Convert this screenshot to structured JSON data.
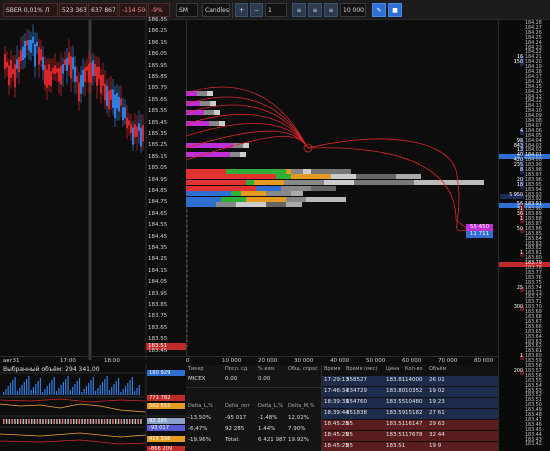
{
  "toolbar": {
    "ticker": "SBER 0,01% Л",
    "ticker_val1": "523 363",
    "ticker_val2": "637 867",
    "ticker_val3": "-114 504",
    "ticker_pct": "-9%",
    "mode": "SM",
    "chart_type": "Candles",
    "interval": "1",
    "volume_filter": "10 000"
  },
  "price_axis_left": [
    "186.35",
    "186.25",
    "186.15",
    "186.05",
    "185.95",
    "185.85",
    "185.75",
    "185.65",
    "185.55",
    "185.45",
    "185.35",
    "185.25",
    "185.15",
    "185.05",
    "184.95",
    "184.85",
    "184.75",
    "184.65",
    "184.55",
    "184.45",
    "184.35",
    "184.25",
    "184.15",
    "184.05",
    "183.95",
    "183.85",
    "183.75",
    "183.65",
    "183.55",
    "183.45"
  ],
  "current_price_left": "183.51",
  "time_axis": [
    "авг31",
    "17:00",
    "18:00"
  ],
  "selected_volume_label": "Выбранный объём: 294 341,00",
  "indicator_values": [
    "180 929",
    "771 782",
    "502 553",
    "92 285",
    "-93 017",
    "415 556",
    "-866 209"
  ],
  "cluster_axis": [
    "0",
    "10 000",
    "20 000",
    "30 000",
    "40 000",
    "50 000",
    "60 000",
    "70 000",
    "80 000"
  ],
  "cluster_labels": [
    "4",
    "1",
    "3",
    "3",
    "1",
    "2",
    "1",
    "2",
    "2"
  ],
  "cluster_pos_badges": [
    "1",
    "2"
  ],
  "order_tag_sell": "55 450",
  "order_tag_buy": "11 711",
  "orderbook": {
    "prices": [
      "184.28",
      "184.27",
      "184.26",
      "184.25",
      "184.24",
      "184.23",
      "184.22",
      "184.21",
      "184.20",
      "184.19",
      "184.18",
      "184.17",
      "184.16",
      "184.15",
      "184.14",
      "184.13",
      "184.12",
      "184.11",
      "184.10",
      "184.09",
      "184.08",
      "184.07",
      "184.06",
      "184.05",
      "184.04",
      "184.03",
      "184.02",
      "184.01",
      "184.00",
      "183.99",
      "183.98",
      "183.97",
      "183.96",
      "183.95",
      "183.94",
      "183.93",
      "183.92",
      "183.91",
      "183.90",
      "183.89",
      "183.88",
      "183.87",
      "183.86",
      "183.85",
      "183.84",
      "183.83",
      "183.82",
      "183.81",
      "183.80",
      "183.79",
      "183.78",
      "183.77",
      "183.76",
      "183.75",
      "183.74",
      "183.73",
      "183.72",
      "183.71",
      "183.70",
      "183.69",
      "183.68",
      "183.67",
      "183.66",
      "183.65",
      "183.64",
      "183.63",
      "183.62",
      "183.61",
      "183.60",
      "183.59",
      "183.58",
      "183.57",
      "183.56",
      "183.55",
      "183.54",
      "183.53",
      "183.52",
      "183.51",
      "183.50",
      "183.49",
      "183.48",
      "183.47",
      "183.46",
      "183.45",
      "183.44",
      "183.43",
      "183.42",
      "183.41",
      "183.40"
    ],
    "volumes": {
      "184.21": "16",
      "184.20": "150",
      "184.06": "4",
      "184.04": "98",
      "184.03": "843",
      "184.02": "13",
      "184.01": "40",
      "184.00": "420",
      "183.99": "235",
      "183.98": "8",
      "183.96": "20",
      "183.95": "18",
      "183.93": "5 950",
      "183.91": "56",
      "183.90": "31",
      "183.89": "36",
      "183.88": "1",
      "183.86": "50",
      "183.81": "1",
      "183.74": "25",
      "183.70": "300",
      "183.60": "1",
      "183.57": "200"
    },
    "volume_ratio": {
      "184.21": 0.01,
      "184.20": 0.02,
      "184.06": 0.003,
      "184.04": 0.015,
      "184.03": 0.14,
      "184.02": 0.002,
      "184.01": 0.006,
      "184.00": 0.07,
      "183.99": 0.04,
      "183.98": 0.002,
      "183.96": 0.003,
      "183.95": 0.003,
      "183.93": 1.0,
      "183.91": 0.009,
      "183.90": 0.005,
      "183.89": 0.006,
      "183.88": 0.001,
      "183.86": 0.009,
      "183.81": 0.001,
      "183.74": 0.004,
      "183.70": 0.05,
      "183.60": 0.001,
      "183.57": 0.03
    },
    "highlight_ask": "184.01",
    "highlight_bid": "183.91",
    "cursor_price": "183.79"
  },
  "flow_table": {
    "headers": [
      "Тикер",
      "Посл. сд.",
      "% изм.",
      "Общ. спрос"
    ],
    "row1": [
      "MICEX",
      "0.00",
      "0.00",
      ""
    ],
    "delta_headers": [
      "Delta_L,%",
      "Delta_лот",
      "Delta_L,%",
      "Delta_M,%"
    ],
    "rows": [
      [
        "-13,50%",
        "-95 017",
        "-1.48%",
        "12,02%"
      ],
      [
        "-6,47%",
        "92 285",
        "1.44%",
        "7.90%"
      ],
      [
        "-19,96%",
        "Total:",
        "6 421 987",
        "19.92%"
      ]
    ]
  },
  "trades": {
    "headers": [
      "Время",
      "Время (мкс)",
      "Цена",
      "Кол-во",
      "Объём"
    ],
    "rows": [
      [
        "17:29:13",
        "358527",
        "183.81",
        "14000",
        "26 01"
      ],
      [
        "17:46:34",
        "234729",
        "183.80",
        "10352",
        "19 02"
      ],
      [
        "18:39:33",
        "654760",
        "183.55",
        "10480",
        "19 23"
      ],
      [
        "18:39:44",
        "351838",
        "183.59",
        "15182",
        "27 61"
      ],
      [
        "18:45:25",
        "85",
        "183.51",
        "16147",
        "29 63"
      ],
      [
        "18:45:25",
        "85",
        "183.51",
        "17678",
        "32 44"
      ],
      [
        "18:45:25",
        "85",
        "183.51",
        "",
        "19 9"
      ]
    ]
  },
  "colors": {
    "up": "#2f7de1",
    "down": "#d8262b",
    "bg": "#0d0d0d",
    "toolbar": "#1c1c1c"
  }
}
